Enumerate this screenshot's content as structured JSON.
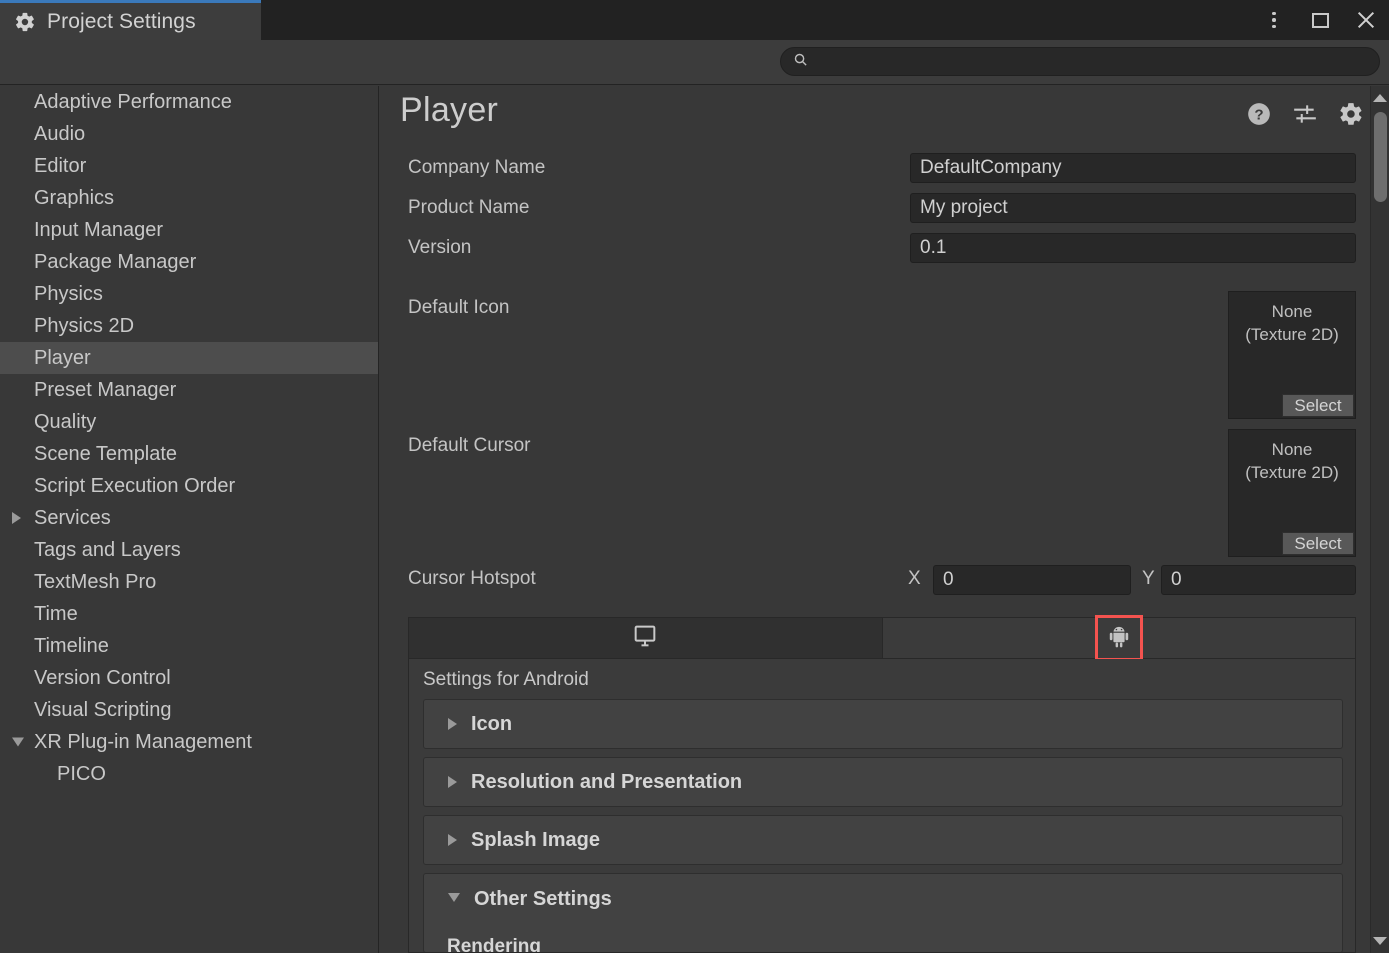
{
  "window": {
    "tab_title": "Project Settings",
    "tab_icon": "gear-icon",
    "controls": {
      "menu": "kebab-menu-icon",
      "maximize": "maximize-icon",
      "close": "close-icon"
    },
    "accent_color": "#3a79bb"
  },
  "search": {
    "value": "",
    "placeholder": "",
    "icon": "search-icon"
  },
  "sidebar": {
    "items": [
      {
        "label": "Adaptive Performance",
        "arrow": "none",
        "selected": false,
        "child": false
      },
      {
        "label": "Audio",
        "arrow": "none",
        "selected": false,
        "child": false
      },
      {
        "label": "Editor",
        "arrow": "none",
        "selected": false,
        "child": false
      },
      {
        "label": "Graphics",
        "arrow": "none",
        "selected": false,
        "child": false
      },
      {
        "label": "Input Manager",
        "arrow": "none",
        "selected": false,
        "child": false
      },
      {
        "label": "Package Manager",
        "arrow": "none",
        "selected": false,
        "child": false
      },
      {
        "label": "Physics",
        "arrow": "none",
        "selected": false,
        "child": false
      },
      {
        "label": "Physics 2D",
        "arrow": "none",
        "selected": false,
        "child": false
      },
      {
        "label": "Player",
        "arrow": "none",
        "selected": true,
        "child": false
      },
      {
        "label": "Preset Manager",
        "arrow": "none",
        "selected": false,
        "child": false
      },
      {
        "label": "Quality",
        "arrow": "none",
        "selected": false,
        "child": false
      },
      {
        "label": "Scene Template",
        "arrow": "none",
        "selected": false,
        "child": false
      },
      {
        "label": "Script Execution Order",
        "arrow": "none",
        "selected": false,
        "child": false
      },
      {
        "label": "Services",
        "arrow": "collapsed",
        "selected": false,
        "child": false
      },
      {
        "label": "Tags and Layers",
        "arrow": "none",
        "selected": false,
        "child": false
      },
      {
        "label": "TextMesh Pro",
        "arrow": "none",
        "selected": false,
        "child": false
      },
      {
        "label": "Time",
        "arrow": "none",
        "selected": false,
        "child": false
      },
      {
        "label": "Timeline",
        "arrow": "none",
        "selected": false,
        "child": false
      },
      {
        "label": "Version Control",
        "arrow": "none",
        "selected": false,
        "child": false
      },
      {
        "label": "Visual Scripting",
        "arrow": "none",
        "selected": false,
        "child": false
      },
      {
        "label": "XR Plug-in Management",
        "arrow": "expanded",
        "selected": false,
        "child": false
      },
      {
        "label": "PICO",
        "arrow": "none",
        "selected": false,
        "child": true
      }
    ]
  },
  "main": {
    "title": "Player",
    "header_icons": [
      {
        "name": "help-icon"
      },
      {
        "name": "preset-icon"
      },
      {
        "name": "settings-gear-icon"
      }
    ],
    "fields": [
      {
        "label": "Company Name",
        "value": "DefaultCompany"
      },
      {
        "label": "Product Name",
        "value": "My project"
      },
      {
        "label": "Version",
        "value": "0.1"
      }
    ],
    "object_fields": [
      {
        "label": "Default Icon",
        "value_line1": "None",
        "value_line2": "(Texture 2D)",
        "select_label": "Select"
      },
      {
        "label": "Default Cursor",
        "value_line1": "None",
        "value_line2": "(Texture 2D)",
        "select_label": "Select"
      }
    ],
    "cursor_hotspot": {
      "label": "Cursor Hotspot",
      "x_label": "X",
      "x_value": "0",
      "y_label": "Y",
      "y_value": "0"
    },
    "platform_tabs": [
      {
        "icon": "desktop-monitor-icon",
        "active": true,
        "highlighted": false
      },
      {
        "icon": "android-robot-icon",
        "active": false,
        "highlighted": true
      }
    ],
    "highlight_color": "#f4534f",
    "settings_panel": {
      "title": "Settings for Android",
      "sections": [
        {
          "label": "Icon",
          "state": "collapsed"
        },
        {
          "label": "Resolution and Presentation",
          "state": "collapsed"
        },
        {
          "label": "Splash Image",
          "state": "collapsed"
        },
        {
          "label": "Other Settings",
          "state": "expanded"
        }
      ],
      "sub_label": "Rendering"
    }
  },
  "scrollbar": {
    "up_arrow": "scroll-up-arrow-icon",
    "down_arrow": "scroll-down-arrow-icon",
    "thumb": "scroll-thumb"
  }
}
